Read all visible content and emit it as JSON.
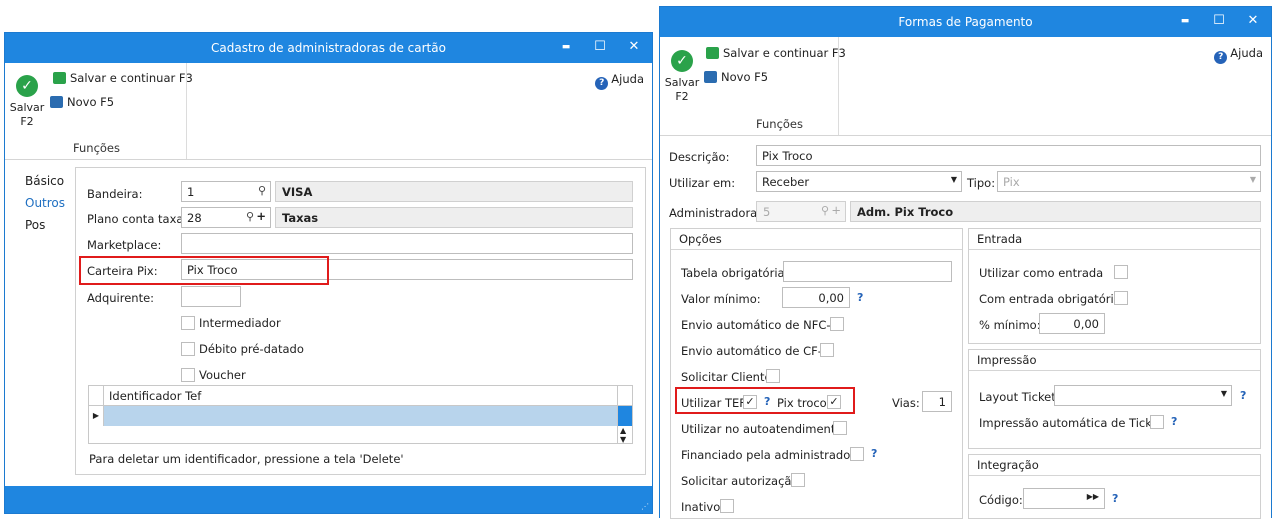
{
  "window1": {
    "title": "Cadastro de administradoras de cartão",
    "controls": {
      "minimize": "▬",
      "maximize": "☐",
      "close": "✕"
    },
    "ribbon": {
      "save_label_line1": "Salvar",
      "save_label_line2": "F2",
      "save_continue": "Salvar e continuar F3",
      "new": "Novo F5",
      "group": "Funções",
      "help": "Ajuda"
    },
    "tabs": [
      "Básico",
      "Outros",
      "Pos"
    ],
    "active_tab": "Outros",
    "form": {
      "bandeira_label": "Bandeira:",
      "bandeira_code": "1",
      "bandeira_name": "VISA",
      "plano_label": "Plano conta taxa:",
      "plano_code": "28",
      "plano_name": "Taxas",
      "marketplace_label": "Marketplace:",
      "marketplace_value": "",
      "carteira_label": "Carteira Pix:",
      "carteira_value": "Pix Troco",
      "adquirente_label": "Adquirente:",
      "adquirente_value": "",
      "intermediador": "Intermediador",
      "debito": "Débito pré-datado",
      "voucher": "Voucher",
      "grid_header": "Identificador Tef",
      "hint": "Para deletar um identificador, pressione a tela 'Delete'"
    }
  },
  "window2": {
    "title": "Formas de Pagamento",
    "controls": {
      "minimize": "▬",
      "maximize": "☐",
      "close": "✕"
    },
    "ribbon": {
      "save_label_line1": "Salvar",
      "save_label_line2": "F2",
      "save_continue": "Salvar e continuar F3",
      "new": "Novo F5",
      "group": "Funções",
      "help": "Ajuda"
    },
    "form": {
      "descricao_label": "Descrição:",
      "descricao_value": "Pix Troco",
      "utilizar_label": "Utilizar em:",
      "utilizar_value": "Receber",
      "tipo_label": "Tipo:",
      "tipo_value": "Pix",
      "admin_label": "Administradora:",
      "admin_code": "5",
      "admin_name": "Adm. Pix Troco"
    },
    "opcoes": {
      "title": "Opções",
      "tabela_label": "Tabela obrigatória:",
      "valor_label": "Valor mínimo:",
      "valor_value": "0,00",
      "nfce": "Envio automático de NFC-e",
      "cfe": "Envio automático de CF-e",
      "solicitar_cliente": "Solicitar Cliente",
      "utilizar_tef": "Utilizar TEF",
      "pix_troco": "Pix troco",
      "vias_label": "Vias:",
      "vias_value": "1",
      "autoatendimento": "Utilizar no autoatendimento",
      "financiado": "Financiado pela administradora",
      "solicitar_autorizacao": "Solicitar autorização",
      "inativo": "Inativo"
    },
    "entrada": {
      "title": "Entrada",
      "utilizar_entrada": "Utilizar como entrada",
      "com_entrada": "Com entrada obrigatória",
      "minimo_label": "% mínimo:",
      "minimo_value": "0,00"
    },
    "impressao": {
      "title": "Impressão",
      "layout_label": "Layout Ticket:",
      "layout_value": "",
      "auto_ticket": "Impressão automática de Ticket"
    },
    "integracao": {
      "title": "Integração",
      "codigo_label": "Código:",
      "codigo_value": ""
    }
  }
}
